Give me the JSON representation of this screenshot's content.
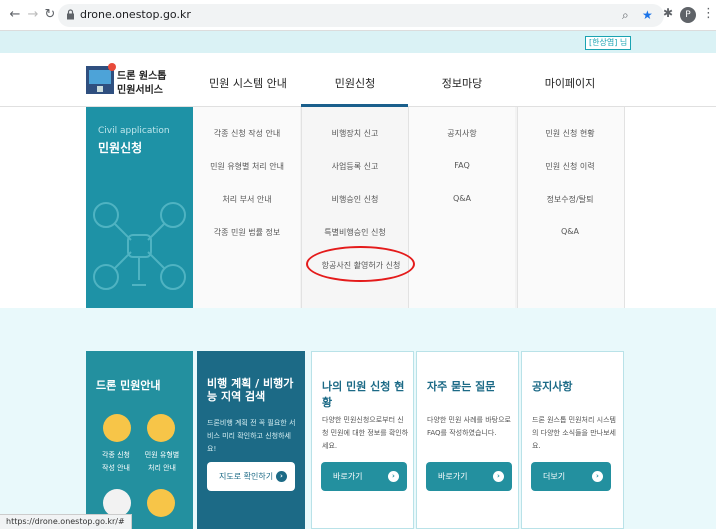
{
  "browser": {
    "url": "drone.onestop.go.kr",
    "profile_initial": "P"
  },
  "topbar": {
    "lang_label": "[한상엽] 님"
  },
  "logo": {
    "line1": "드론 원스톱",
    "line2": "민원서비스"
  },
  "gnb": [
    "민원 시스템 안내",
    "민원신청",
    "정보마당",
    "마이페이지"
  ],
  "mega": {
    "title_en": "Civil application",
    "title_ko": "민원신청",
    "col1": [
      "각종 신청 작성 안내",
      "민원 유형별 처리 안내",
      "처리 부서 안내",
      "각종 민원 법률 정보"
    ],
    "col2": [
      "비행장치 신고",
      "사업등록 신고",
      "비행승인 신청",
      "특별비행승인 신청",
      "항공사진 촬영허가 신청"
    ],
    "col3": [
      "공지사항",
      "FAQ",
      "Q&A"
    ],
    "col4": [
      "민원 신청 현황",
      "민원 신청 이력",
      "정보수정/탈퇴",
      "Q&A"
    ]
  },
  "cards": {
    "guide": {
      "title": "드론 민원안내",
      "item1": "각종 신청\n작성 안내",
      "item2": "민원 유형별\n처리 안내"
    },
    "map": {
      "title": "비행 계획 / 비행가능 지역 검색",
      "desc": "드론비행 계획 전 꼭 필요한 서비스 미리 확인하고 신청하세요!",
      "btn": "지도로 확인하기"
    },
    "status": {
      "title": "나의 민원 신청 현황",
      "desc": "다양한 민원신청으로부터 신청 민원에 대한 정보를 확인하세요.",
      "btn": "바로가기"
    },
    "faq": {
      "title": "자주 묻는 질문",
      "desc": "다양한 민원 사례를 바탕으로 FAQ를 작성하였습니다.",
      "btn": "바로가기"
    },
    "notice": {
      "title": "공지사항",
      "desc": "드론 원스톱 민원처리 시스템의 다양한 소식들을 만나보세요.",
      "btn": "더보기"
    }
  },
  "status_bar": "https://drone.onestop.go.kr/#",
  "colors": {
    "teal": "#23909f",
    "dark_teal": "#1c6a86",
    "highlight": "#e41b1b"
  }
}
